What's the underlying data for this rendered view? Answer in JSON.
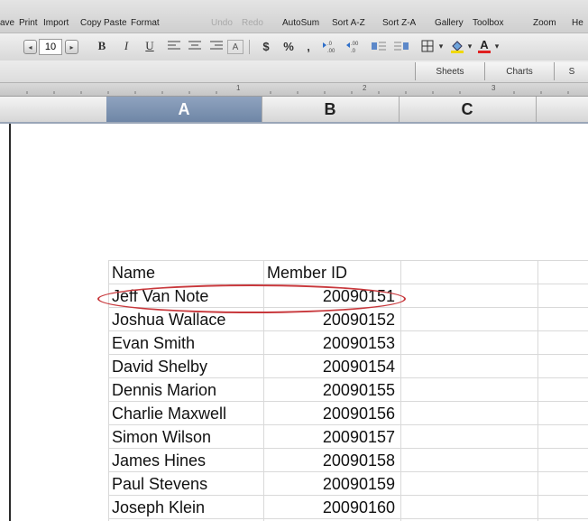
{
  "toolbar": {
    "labels": [
      "ave",
      "Print",
      "Import",
      "Copy",
      "Paste",
      "Format",
      "Undo",
      "Redo",
      "AutoSum",
      "Sort A-Z",
      "Sort Z-A",
      "Gallery",
      "Toolbox",
      "Zoom",
      "He"
    ]
  },
  "format_bar": {
    "font_size": "10",
    "bold": "B",
    "italic": "I",
    "underline": "U",
    "currency": "$",
    "percent": "%",
    "comma": ","
  },
  "ribbon": {
    "tabs": [
      "Sheets",
      "Charts",
      "S"
    ]
  },
  "ruler": {
    "marks": [
      "1",
      "2",
      "3"
    ]
  },
  "columns": [
    "A",
    "B",
    "C"
  ],
  "selected_column": "A",
  "table": {
    "headers": [
      "Name",
      "Member ID"
    ],
    "rows": [
      [
        "Jeff Van Note",
        "20090151"
      ],
      [
        "Joshua Wallace",
        "20090152"
      ],
      [
        "Evan Smith",
        "20090153"
      ],
      [
        "David Shelby",
        "20090154"
      ],
      [
        "Dennis Marion",
        "20090155"
      ],
      [
        "Charlie Maxwell",
        "20090156"
      ],
      [
        "Simon Wilson",
        "20090157"
      ],
      [
        "James Hines",
        "20090158"
      ],
      [
        "Paul Stevens",
        "20090159"
      ],
      [
        "Joseph Klein",
        "20090160"
      ]
    ]
  },
  "colors": {
    "highlight": "#c8383c",
    "selected_header": "#7d92b1"
  }
}
